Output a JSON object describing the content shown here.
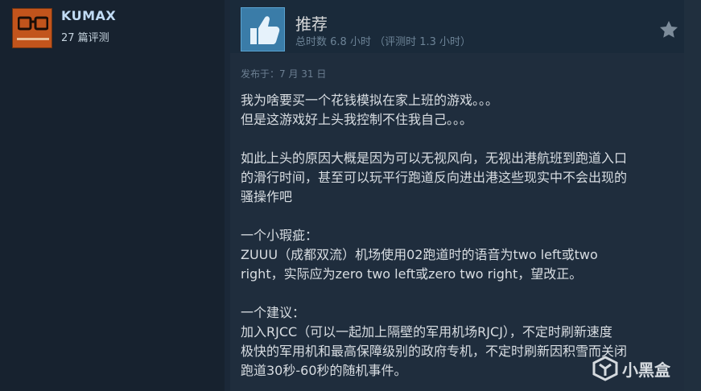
{
  "user": {
    "name": "KUMAX",
    "review_count": "27 篇评测",
    "avatar_icon": "glasses-avatar-icon"
  },
  "review": {
    "verdict": "推荐",
    "hours": "总时数 6.8 小时 （评测时 1.3 小时）",
    "posted": "发布于：7 月 31 日",
    "paragraphs": [
      [
        "我为啥要买一个花钱模拟在家上班的游戏。。。",
        "但是这游戏好上头我控制不住我自己。。。"
      ],
      [
        "如此上头的原因大概是因为可以无视风向，无视出港航班到跑道入口",
        "的滑行时间，甚至可以玩平行跑道反向进出港这些现实中不会出现的",
        "骚操作吧"
      ],
      [
        "一个小瑕疵：",
        "ZUUU（成都双流）机场使用02跑道时的语音为two left或two",
        "right，实际应为zero two left或zero two right，望改正。"
      ],
      [
        "一个建议：",
        "加入RJCC（可以一起加上隔壁的军用机场RJCJ），不定时刷新速度",
        "极快的军用机和最高保障级别的政府专机，不定时刷新因积雪而关闭",
        "跑道30秒-60秒的随机事件。"
      ]
    ]
  },
  "watermark": {
    "text": "小黑盒"
  },
  "colors": {
    "background": "#1b2838",
    "username": "#c1dbf4",
    "thumb": "#3a7ca8"
  }
}
